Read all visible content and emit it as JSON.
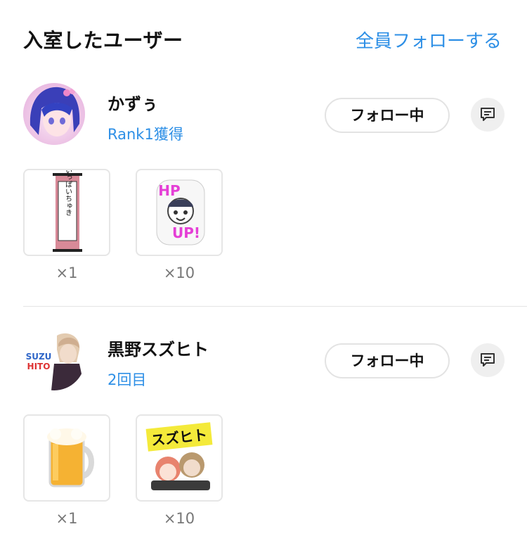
{
  "header": {
    "title": "入室したユーザー",
    "follow_all": "全員フォローする"
  },
  "users": [
    {
      "name": "かずぅ",
      "subtitle": "Rank1獲得",
      "follow_label": "フォロー中",
      "gifts": [
        {
          "icon": "hanging-scroll-sticker",
          "count": "×1",
          "scroll_text": "いっぱいちゅき"
        },
        {
          "icon": "hp-up-sticker",
          "count": "×10",
          "sticker_text_top": "HP",
          "sticker_text_bottom": "UP!"
        }
      ]
    },
    {
      "name": "黒野スズヒト",
      "subtitle": "2回目",
      "follow_label": "フォロー中",
      "avatar_text_top": "SUZU",
      "avatar_text_bottom": "HITO",
      "gifts": [
        {
          "icon": "beer-mug-sticker",
          "count": "×1"
        },
        {
          "icon": "suzuhito-sticker",
          "count": "×10",
          "sticker_text": "スズヒト"
        }
      ]
    }
  ],
  "colors": {
    "accent": "#2d8fe6",
    "count_text": "#777777",
    "border": "#e3e3e3"
  }
}
